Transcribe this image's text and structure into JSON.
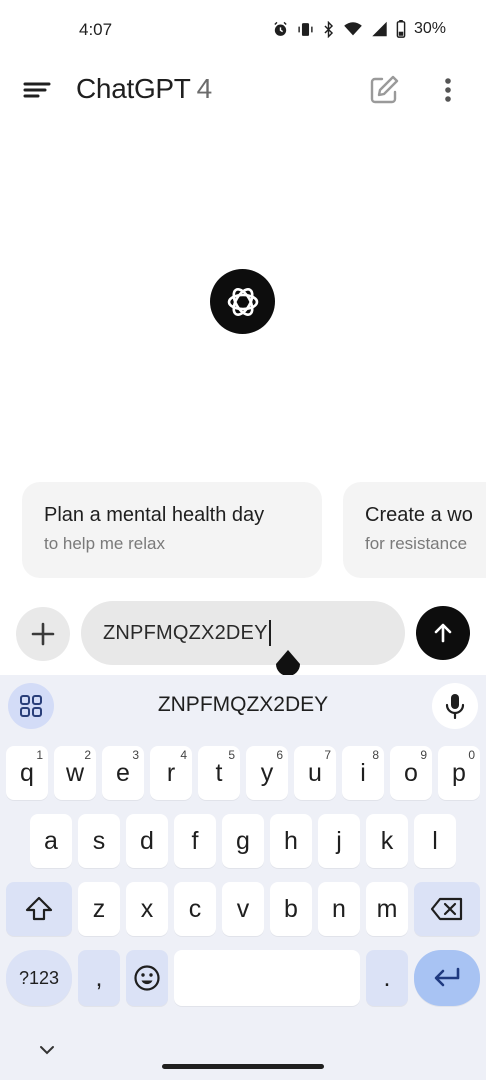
{
  "status_bar": {
    "time": "4:07",
    "battery": "30%"
  },
  "app_bar": {
    "title": "ChatGPT",
    "version": "4"
  },
  "suggestions": [
    {
      "title": "Plan a mental health day",
      "subtitle": "to help me relax"
    },
    {
      "title": "Create a wo",
      "subtitle": "for resistance"
    }
  ],
  "composer": {
    "value": "ZNPFMQZX2DEY"
  },
  "keyboard": {
    "suggestion": "ZNPFMQZX2DEY",
    "row1": [
      {
        "k": "q",
        "h": "1"
      },
      {
        "k": "w",
        "h": "2"
      },
      {
        "k": "e",
        "h": "3"
      },
      {
        "k": "r",
        "h": "4"
      },
      {
        "k": "t",
        "h": "5"
      },
      {
        "k": "y",
        "h": "6"
      },
      {
        "k": "u",
        "h": "7"
      },
      {
        "k": "i",
        "h": "8"
      },
      {
        "k": "o",
        "h": "9"
      },
      {
        "k": "p",
        "h": "0"
      }
    ],
    "row2": [
      "a",
      "s",
      "d",
      "f",
      "g",
      "h",
      "j",
      "k",
      "l"
    ],
    "row3": [
      "z",
      "x",
      "c",
      "v",
      "b",
      "n",
      "m"
    ],
    "symbols_label": "?123",
    "comma": ",",
    "period": "."
  }
}
